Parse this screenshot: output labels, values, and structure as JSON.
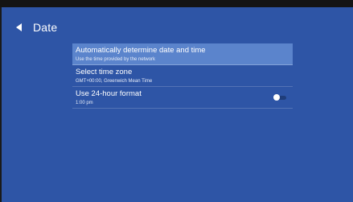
{
  "header": {
    "title": "Date",
    "back_icon": "back-arrow-icon"
  },
  "settings": {
    "items": [
      {
        "title": "Automatically determine date and time",
        "subtitle": "Use the time provided by the network",
        "selected": true
      },
      {
        "title": "Select time zone",
        "subtitle": "GMT+00:00, Greenwich Mean Time",
        "selected": false
      },
      {
        "title": "Use 24-hour format",
        "subtitle": "1:00 pm",
        "selected": false,
        "toggle": "off"
      }
    ]
  },
  "colors": {
    "background": "#2e55a6",
    "selected_row": "#5b84cc",
    "text": "#ffffff"
  }
}
